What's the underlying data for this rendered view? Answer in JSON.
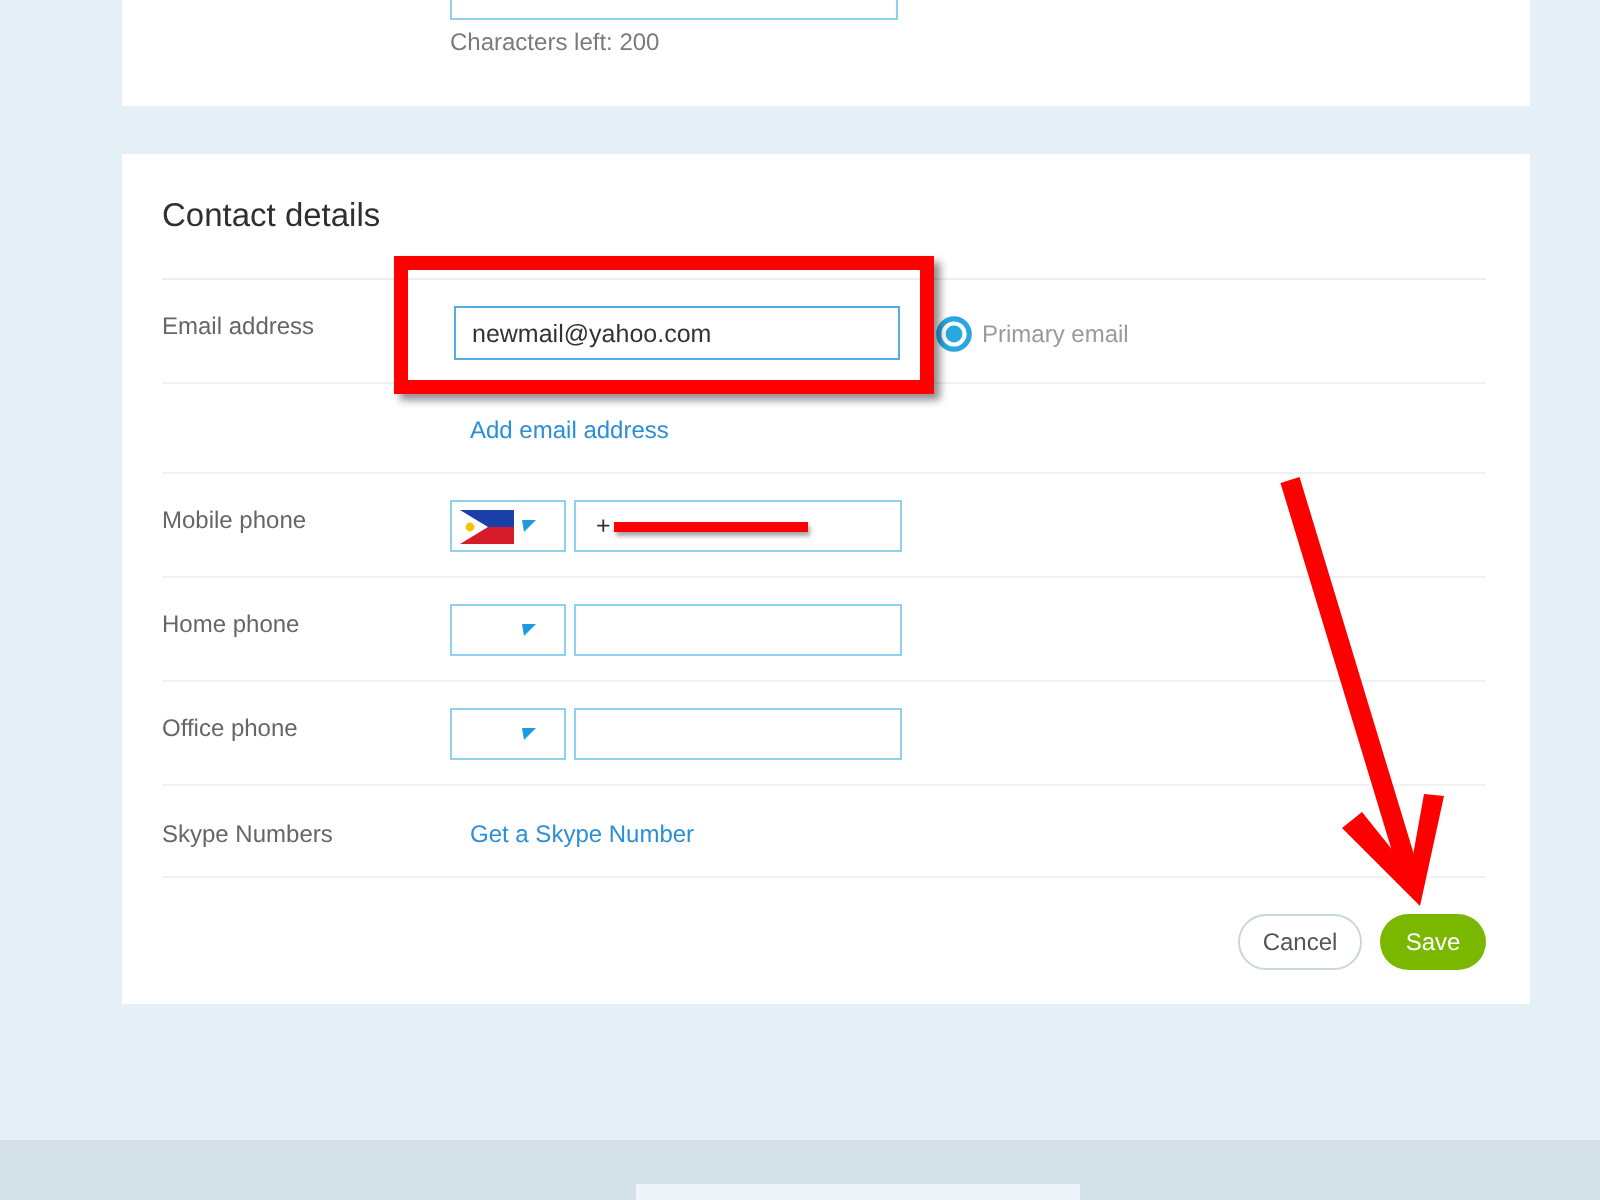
{
  "profile_section": {
    "characters_left": "Characters left: 200"
  },
  "contact_details": {
    "title": "Contact details",
    "email": {
      "label": "Email address",
      "value": "newmail@yahoo.com",
      "primary": {
        "label": "Primary email",
        "selected": true
      }
    },
    "add_email_link": "Add email address",
    "phones": [
      {
        "label": "Mobile phone",
        "country_selected": true,
        "value": "+",
        "redacted": true
      },
      {
        "label": "Home phone",
        "country_selected": false
      },
      {
        "label": "Office phone",
        "country_selected": false
      }
    ],
    "skype_numbers": {
      "label": "Skype Numbers",
      "link": "Get a Skype Number"
    },
    "buttons": [
      {
        "label": "Cancel",
        "kind": "secondary"
      },
      {
        "label": "Save",
        "kind": "primary"
      }
    ]
  }
}
